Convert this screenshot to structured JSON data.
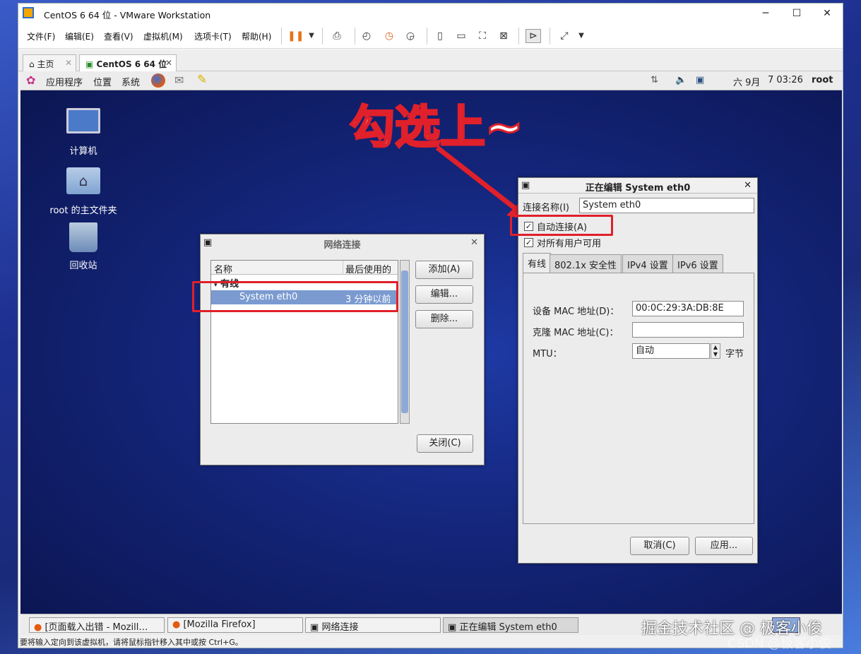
{
  "window": {
    "title": "CentOS 6 64 位 - VMware Workstation",
    "min_icon": "minimize-icon",
    "max_icon": "maximize-icon",
    "close_icon": "close-icon"
  },
  "menu": [
    "文件(F)",
    "编辑(E)",
    "查看(V)",
    "虚拟机(M)",
    "选项卡(T)",
    "帮助(H)"
  ],
  "tabs": [
    {
      "label": "主页"
    },
    {
      "label": "CentOS 6 64 位"
    }
  ],
  "guest_panel": {
    "apps": "应用程序",
    "places": "位置",
    "system": "系统",
    "date": "六 9月",
    "time": "7 03:26",
    "user": "root"
  },
  "desktop_icons": [
    "计算机",
    "root 的主文件夹",
    "回收站"
  ],
  "annotation": "勾选上~",
  "net_dialog": {
    "title": "网络连接",
    "col_name": "名称",
    "col_last": "最后使用的",
    "group": "有线",
    "row_name": "System eth0",
    "row_time": "3 分钟以前",
    "add": "添加(A)",
    "edit": "编辑...",
    "delete": "删除...",
    "close": "关闭(C)"
  },
  "edit_dialog": {
    "title": "正在编辑 System eth0",
    "conn_label": "连接名称(I)",
    "conn_value": "System eth0",
    "auto": "自动连接(A)",
    "allusers": "对所有用户可用",
    "tabs": [
      "有线",
      "802.1x 安全性",
      "IPv4 设置",
      "IPv6 设置"
    ],
    "mac_label": "设备 MAC 地址(D)：",
    "mac_value": "00:0C:29:3A:DB:8E",
    "clone_label": "克隆 MAC 地址(C)：",
    "clone_value": "",
    "mtu_label": "MTU：",
    "mtu_value": "自动",
    "mtu_unit": "字节",
    "cancel": "取消(C)",
    "apply": "应用..."
  },
  "taskbar": [
    "[页面载入出错 - Mozill…",
    "[Mozilla Firefox]",
    "网络连接",
    "正在编辑 System eth0"
  ],
  "watermark": "掘金技术社区 @ 极客小俊",
  "watermark2": "CSDN @极客小俊",
  "status": "要将输入定向到该虚拟机，请将鼠标指针移入其中或按 Ctrl+G。",
  "colors": {
    "highlight": "#e0202a",
    "selection": "#7b9bd0"
  }
}
